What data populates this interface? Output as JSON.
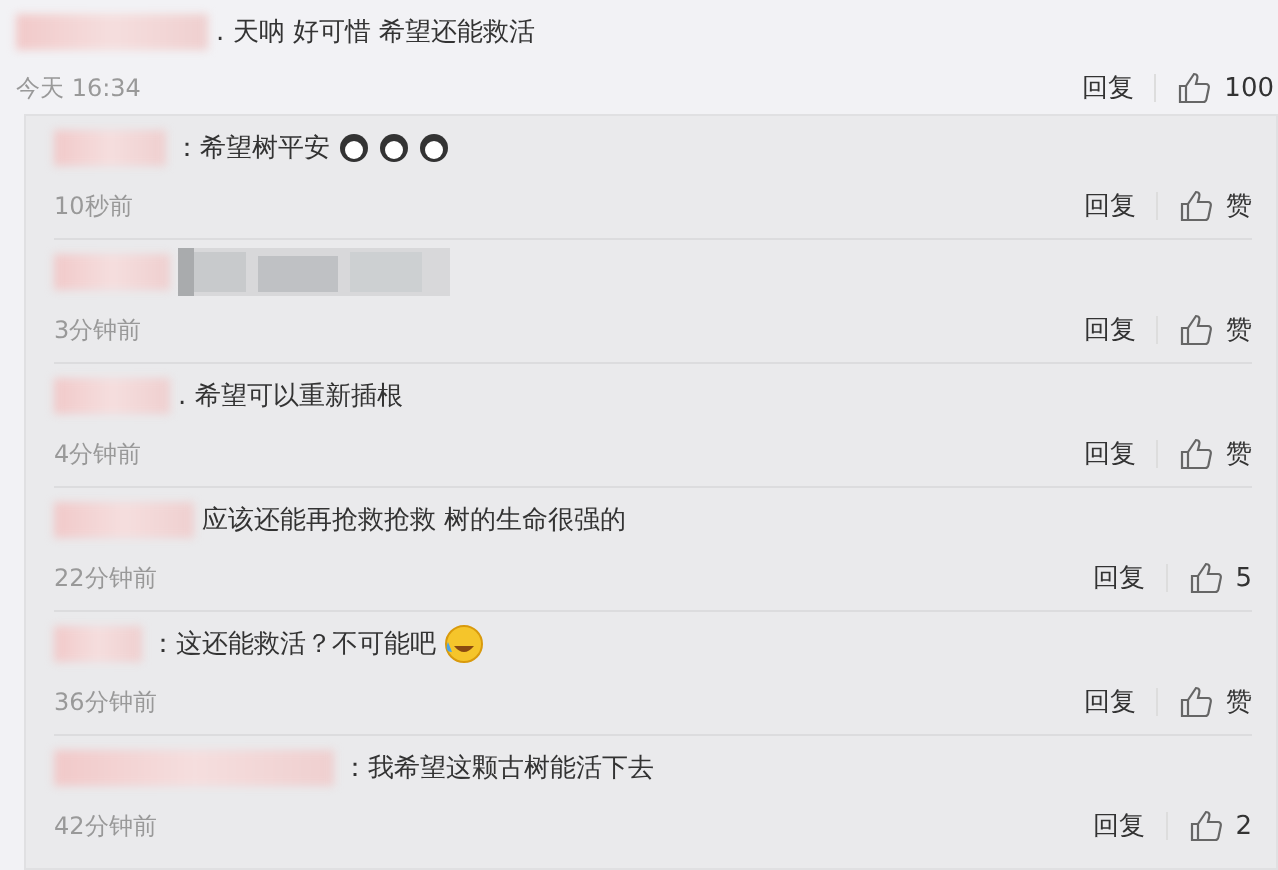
{
  "comment": {
    "text": ". 天呐 好可惜  希望还能救活",
    "time": "今天 16:34",
    "reply": "回复",
    "likes": "100"
  },
  "replies": [
    {
      "text": "：希望树平安",
      "emojis": [
        {
          "kind": "cry"
        },
        {
          "kind": "cry"
        },
        {
          "kind": "cry"
        }
      ],
      "time": "10秒前",
      "reply": "回复",
      "likes": "赞"
    },
    {
      "time": "3分钟前",
      "reply": "回复",
      "likes": "赞"
    },
    {
      "text": ". 希望可以重新插根",
      "time": "4分钟前",
      "reply": "回复",
      "likes": "赞"
    },
    {
      "text": "应该还能再抢救抢救  树的生命很强的",
      "time": "22分钟前",
      "reply": "回复",
      "likes": "5"
    },
    {
      "text": "：这还能救活？不可能吧",
      "emojis": [
        {
          "kind": "laugh-cry"
        }
      ],
      "time": "36分钟前",
      "reply": "回复",
      "likes": "赞"
    },
    {
      "text": "：我希望这颗古树能活下去",
      "time": "42分钟前",
      "reply": "回复",
      "likes": "2"
    }
  ]
}
